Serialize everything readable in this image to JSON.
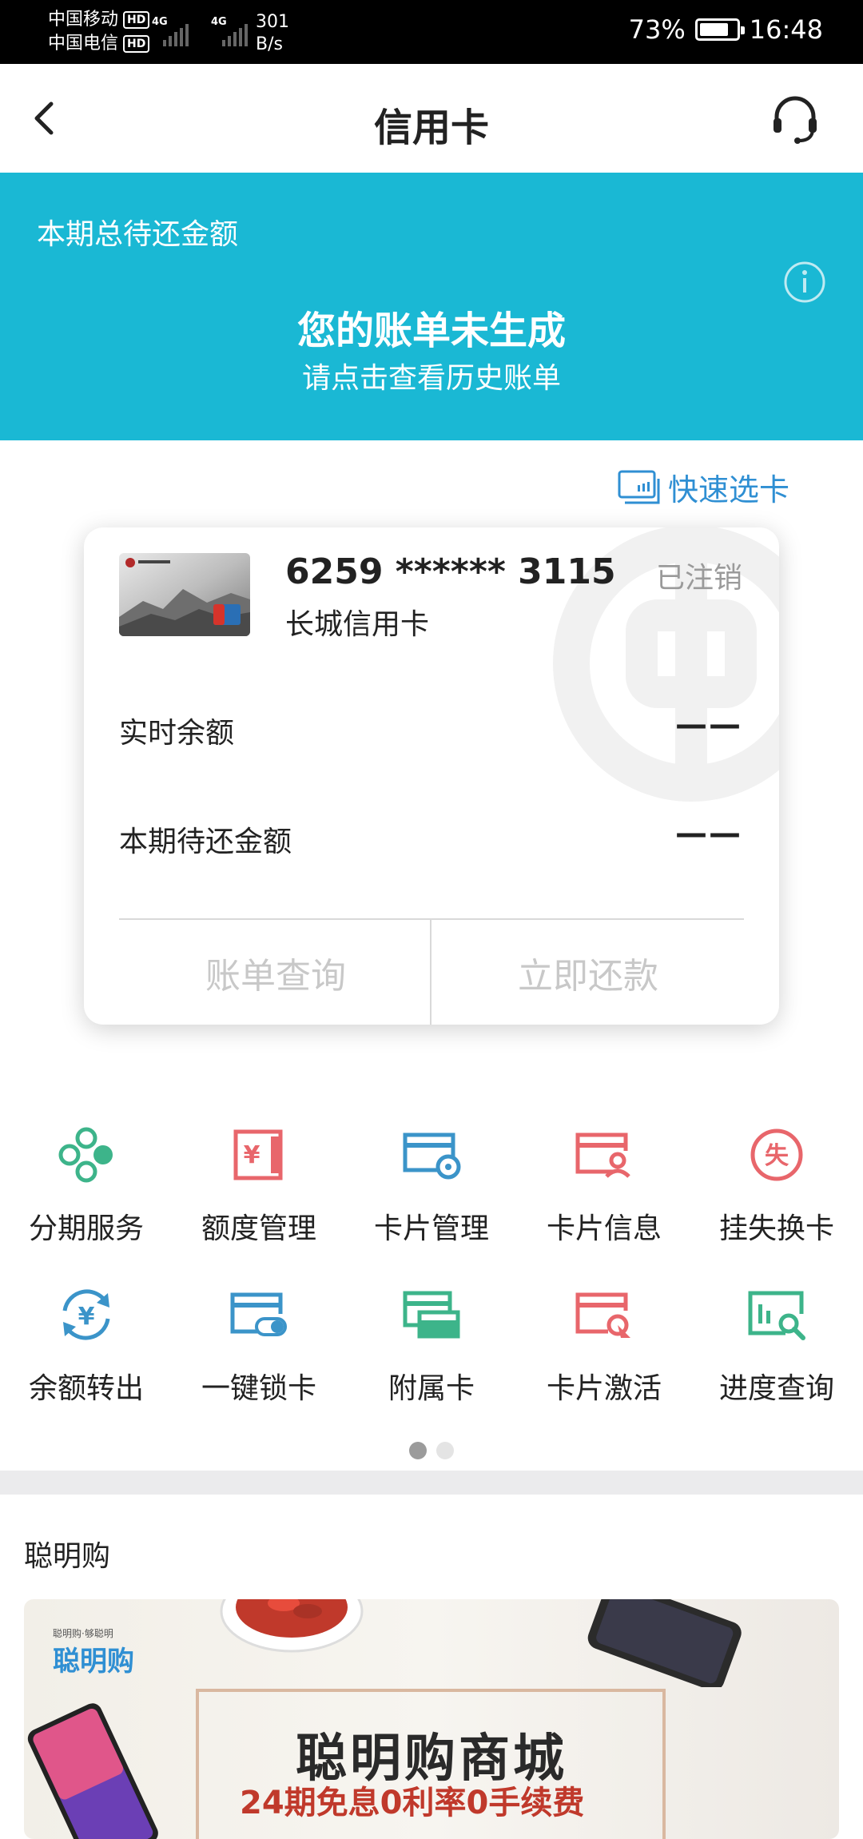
{
  "status_bar": {
    "carrier1": "中国移动",
    "carrier2": "中国电信",
    "hd": "HD",
    "net_type": "4G",
    "speed_value": "301",
    "speed_unit": "B/s",
    "battery": "73%",
    "time": "16:48"
  },
  "header": {
    "title": "信用卡"
  },
  "banner": {
    "label": "本期总待还金额",
    "main": "您的账单未生成",
    "sub": "请点击查看历史账单"
  },
  "quick_select": {
    "label": "快速选卡"
  },
  "card": {
    "number": "6259 ****** 3115",
    "name": "长城信用卡",
    "status": "已注销",
    "balance_label": "实时余额",
    "balance_value": "——",
    "due_label": "本期待还金额",
    "due_value": "——",
    "bill_query": "账单查询",
    "repay_now": "立即还款"
  },
  "services": [
    {
      "label": "分期服务",
      "icon": "installment-icon",
      "color": "#3db48a"
    },
    {
      "label": "额度管理",
      "icon": "credit-limit-icon",
      "color": "#e8666b"
    },
    {
      "label": "卡片管理",
      "icon": "card-settings-icon",
      "color": "#3b94c9"
    },
    {
      "label": "卡片信息",
      "icon": "card-info-icon",
      "color": "#e8666b"
    },
    {
      "label": "挂失换卡",
      "icon": "report-loss-icon",
      "color": "#e8666b"
    },
    {
      "label": "余额转出",
      "icon": "balance-transfer-icon",
      "color": "#3b94c9"
    },
    {
      "label": "一键锁卡",
      "icon": "lock-card-icon",
      "color": "#3b94c9"
    },
    {
      "label": "附属卡",
      "icon": "supplementary-card-icon",
      "color": "#3db48a"
    },
    {
      "label": "卡片激活",
      "icon": "card-activate-icon",
      "color": "#e8666b"
    },
    {
      "label": "进度查询",
      "icon": "progress-query-icon",
      "color": "#3db48a"
    }
  ],
  "pager": {
    "active_index": 0,
    "total": 2
  },
  "section": {
    "title": "聪明购"
  },
  "promo": {
    "logo_small": "聪明购·够聪明",
    "logo": "聪明购",
    "title": "聪明购商城",
    "sub": "24期免息0利率0手续费"
  }
}
